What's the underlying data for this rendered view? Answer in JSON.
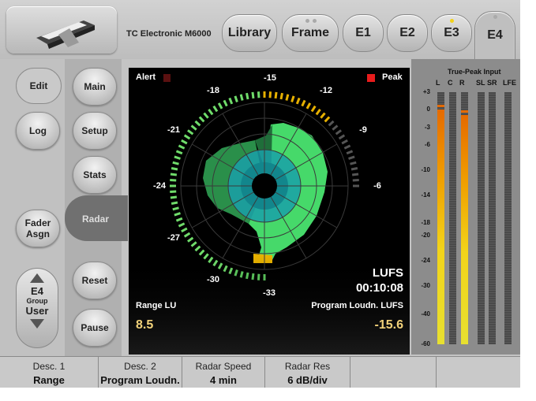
{
  "device_title": "TC Electronic M6000",
  "tabs": [
    {
      "label": "Library",
      "led": false
    },
    {
      "label": "Frame",
      "led": false
    },
    {
      "label": "E1",
      "led": false
    },
    {
      "label": "E2",
      "led": false
    },
    {
      "label": "E3",
      "led": true
    },
    {
      "label": "E4",
      "led": false,
      "active": true
    }
  ],
  "left_buttons": {
    "edit": "Edit",
    "log": "Log",
    "fader_asgn": "Fader Asgn",
    "main": "Main",
    "setup": "Setup",
    "stats": "Stats",
    "radar": "Radar",
    "reset": "Reset",
    "pause": "Pause"
  },
  "group": {
    "engine": "E4",
    "label": "Group",
    "value": "User"
  },
  "radar": {
    "alert_label": "Alert",
    "peak_label": "Peak",
    "ticks": [
      "-15",
      "-12",
      "-9",
      "-6",
      "-33",
      "-30",
      "-27",
      "-24",
      "-21",
      "-18"
    ],
    "lufs_label": "LUFS",
    "time": "00:10:08",
    "range_label": "Range LU",
    "range_value": "8.5",
    "program_label": "Program Loudn. LUFS",
    "program_value": "-15.6",
    "colors": {
      "green": "#2ecf5a",
      "cyan": "#18a8b0",
      "yellow": "#e6b000",
      "value": "#f2d27a"
    }
  },
  "meters": {
    "title": "True-Peak Input",
    "channels": [
      "L",
      "C",
      "R",
      "SL",
      "SR",
      "LFE"
    ],
    "scale": [
      "+3",
      "0",
      "-3",
      "-6",
      "-10",
      "-14",
      "-18",
      "-20",
      "-24",
      "-30",
      "-40",
      "-60"
    ],
    "levels": [
      0.93,
      0.0,
      0.91,
      0.0,
      0.0,
      0.0
    ]
  },
  "bottom": [
    {
      "top": "Desc. 1",
      "bottom": "Range"
    },
    {
      "top": "Desc. 2",
      "bottom": "Program Loudn."
    },
    {
      "top": "Radar Speed",
      "bottom": "4 min"
    },
    {
      "top": "Radar Res",
      "bottom": "6 dB/div"
    }
  ]
}
